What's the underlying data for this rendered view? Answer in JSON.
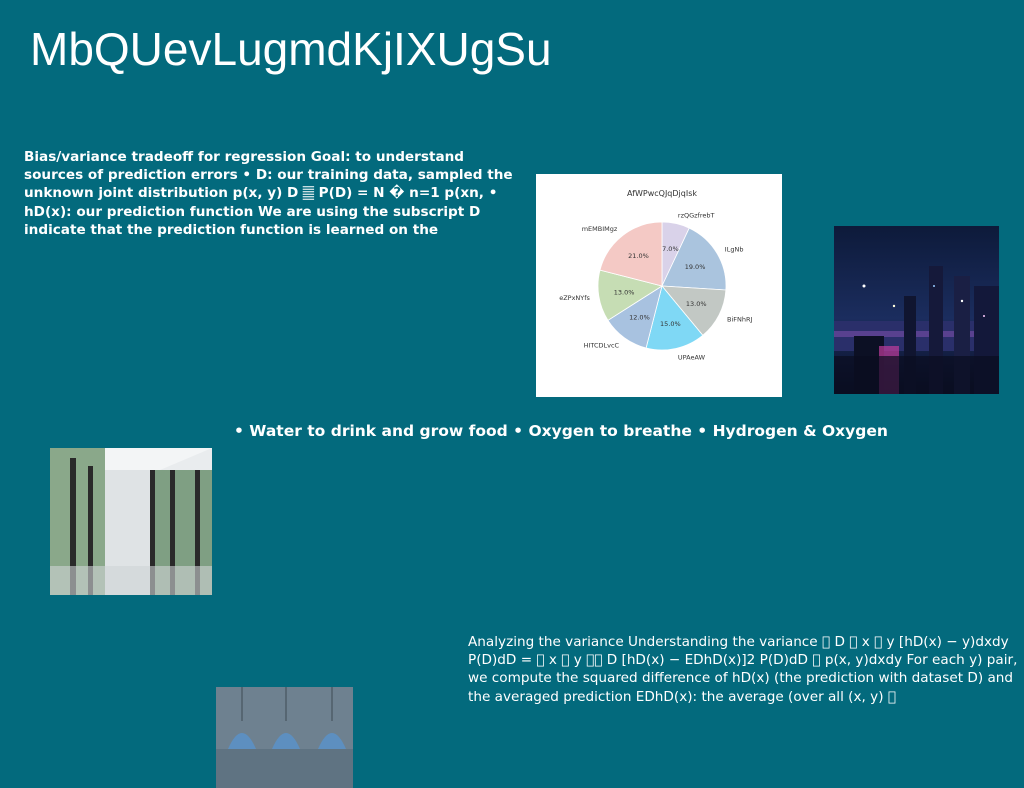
{
  "page": {
    "title": "MbQUevLugmdKjIXUgSu",
    "paragraph1": "Bias/variance tradeoff for regression Goal: to understand sources of prediction errors • D: our training data, sampled the unknown joint distribution p(x, y) D 𝄛 P(D) = N � n=1 p(xn, • hD(x): our prediction function We are using the subscript D indicate that the prediction function is learned on the",
    "bullets": "• Water to drink and grow food • Oxygen to breathe • Hydrogen & Oxygen",
    "paragraph2": "Analyzing the variance Understanding the variance ￿ D ￿ x ￿ y [hD(x) − y)dxdy P(D)dD = ￿ x ￿ y ￿￿ D [hD(x) − EDhD(x)]2 P(D)dD ￿ p(x, y)dxdy For each y) pair, we compute the squared difference of hD(x) (the prediction with dataset D) and the averaged prediction EDhD(x): the average (over all (x, y) ￿"
  },
  "images": {
    "city": "city-night-photo",
    "room": "window-room-photo",
    "lamps": "pendant-lamps-photo"
  },
  "chart_data": {
    "type": "pie",
    "title": "AfWPwcQJqDjqIsk",
    "slices": [
      {
        "label": "rzQGzfrebT",
        "value": 7.0,
        "color": "#d9d2e9"
      },
      {
        "label": "ILgNb",
        "value": 19.0,
        "color": "#aac4de"
      },
      {
        "label": "BiFNhRJ",
        "value": 13.0,
        "color": "#c2c8c4"
      },
      {
        "label": "UPAeAW",
        "value": 15.0,
        "color": "#7fd8f5"
      },
      {
        "label": "HITCDLvcC",
        "value": 12.0,
        "color": "#a8c2e0"
      },
      {
        "label": "eZPxNYfs",
        "value": 13.0,
        "color": "#c6ddb4"
      },
      {
        "label": "mEMBIMgz",
        "value": 21.0,
        "color": "#f4c9c5"
      }
    ],
    "start_angle_deg": 90,
    "direction": "clockwise",
    "legend": "none"
  }
}
